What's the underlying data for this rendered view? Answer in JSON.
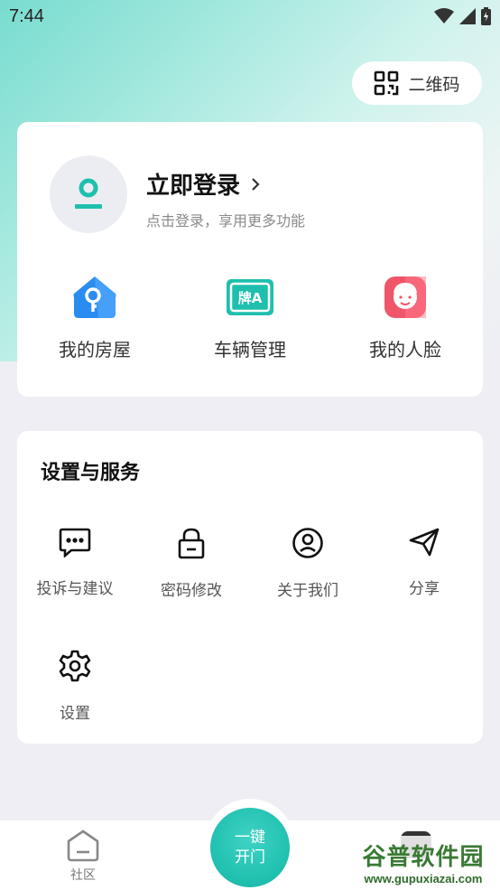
{
  "status_bar": {
    "time": "7:44"
  },
  "header": {
    "qr_label": "二维码"
  },
  "profile": {
    "login_title": "立即登录",
    "login_subtitle": "点击登录，享用更多功能",
    "quick_actions": [
      {
        "label": "我的房屋",
        "icon": "house-key-icon"
      },
      {
        "label": "车辆管理",
        "icon": "license-plate-icon"
      },
      {
        "label": "我的人脸",
        "icon": "face-icon"
      }
    ]
  },
  "services": {
    "title": "设置与服务",
    "items": [
      {
        "label": "投诉与建议",
        "icon": "message-icon"
      },
      {
        "label": "密码修改",
        "icon": "lock-icon"
      },
      {
        "label": "关于我们",
        "icon": "user-circle-icon"
      },
      {
        "label": "分享",
        "icon": "send-icon"
      },
      {
        "label": "设置",
        "icon": "gear-icon"
      }
    ]
  },
  "bottom_nav": {
    "community_label": "社区",
    "open_door_label": "一键开门"
  },
  "watermark": {
    "main": "谷普软件园",
    "url": "www.gupuxiazai.com"
  },
  "colors": {
    "accent": "#1fbfae",
    "brand_blue": "#2a8cf0",
    "face_red": "#f0566a"
  }
}
